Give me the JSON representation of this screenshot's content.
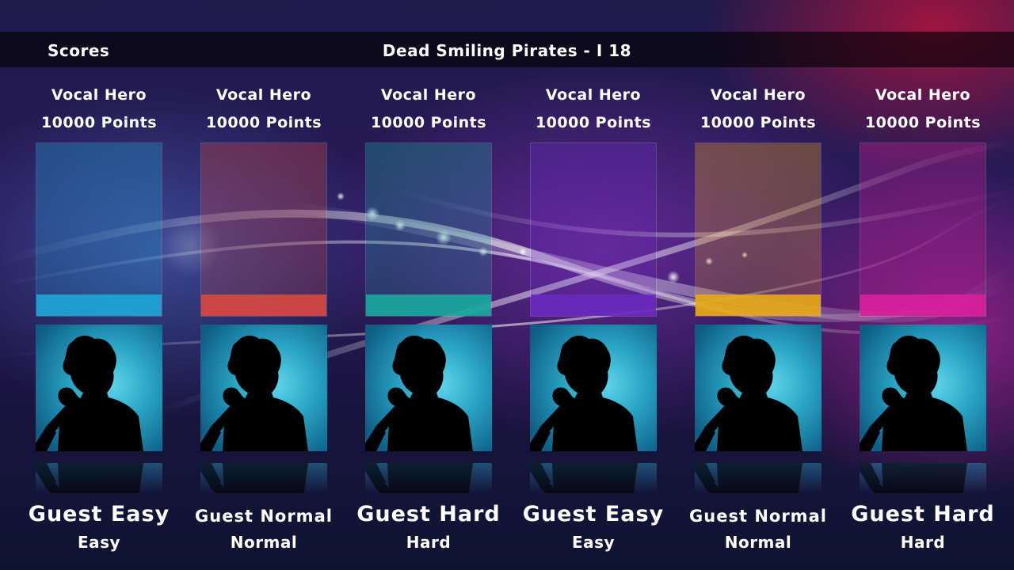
{
  "header": {
    "scores_label": "Scores",
    "song_title": "Dead Smiling Pirates - I 18"
  },
  "players": [
    {
      "instrument": "Vocal Hero",
      "points": "10000 Points",
      "name": "Guest Easy",
      "difficulty": "Easy",
      "color": "#1ea6d8",
      "avatar_icon": "singer-silhouette-icon"
    },
    {
      "instrument": "Vocal Hero",
      "points": "10000 Points",
      "name": "Guest Normal",
      "difficulty": "Normal",
      "color": "#d84840",
      "avatar_icon": "singer-silhouette-icon"
    },
    {
      "instrument": "Vocal Hero",
      "points": "10000 Points",
      "name": "Guest Hard",
      "difficulty": "Hard",
      "color": "#19a9a0",
      "avatar_icon": "singer-silhouette-icon"
    },
    {
      "instrument": "Vocal Hero",
      "points": "10000 Points",
      "name": "Guest Easy",
      "difficulty": "Easy",
      "color": "#6a2ac0",
      "avatar_icon": "singer-silhouette-icon"
    },
    {
      "instrument": "Vocal Hero",
      "points": "10000 Points",
      "name": "Guest Normal",
      "difficulty": "Normal",
      "color": "#e8a818",
      "avatar_icon": "singer-silhouette-icon"
    },
    {
      "instrument": "Vocal Hero",
      "points": "10000 Points",
      "name": "Guest Hard",
      "difficulty": "Hard",
      "color": "#d8209c",
      "avatar_icon": "singer-silhouette-icon"
    }
  ]
}
